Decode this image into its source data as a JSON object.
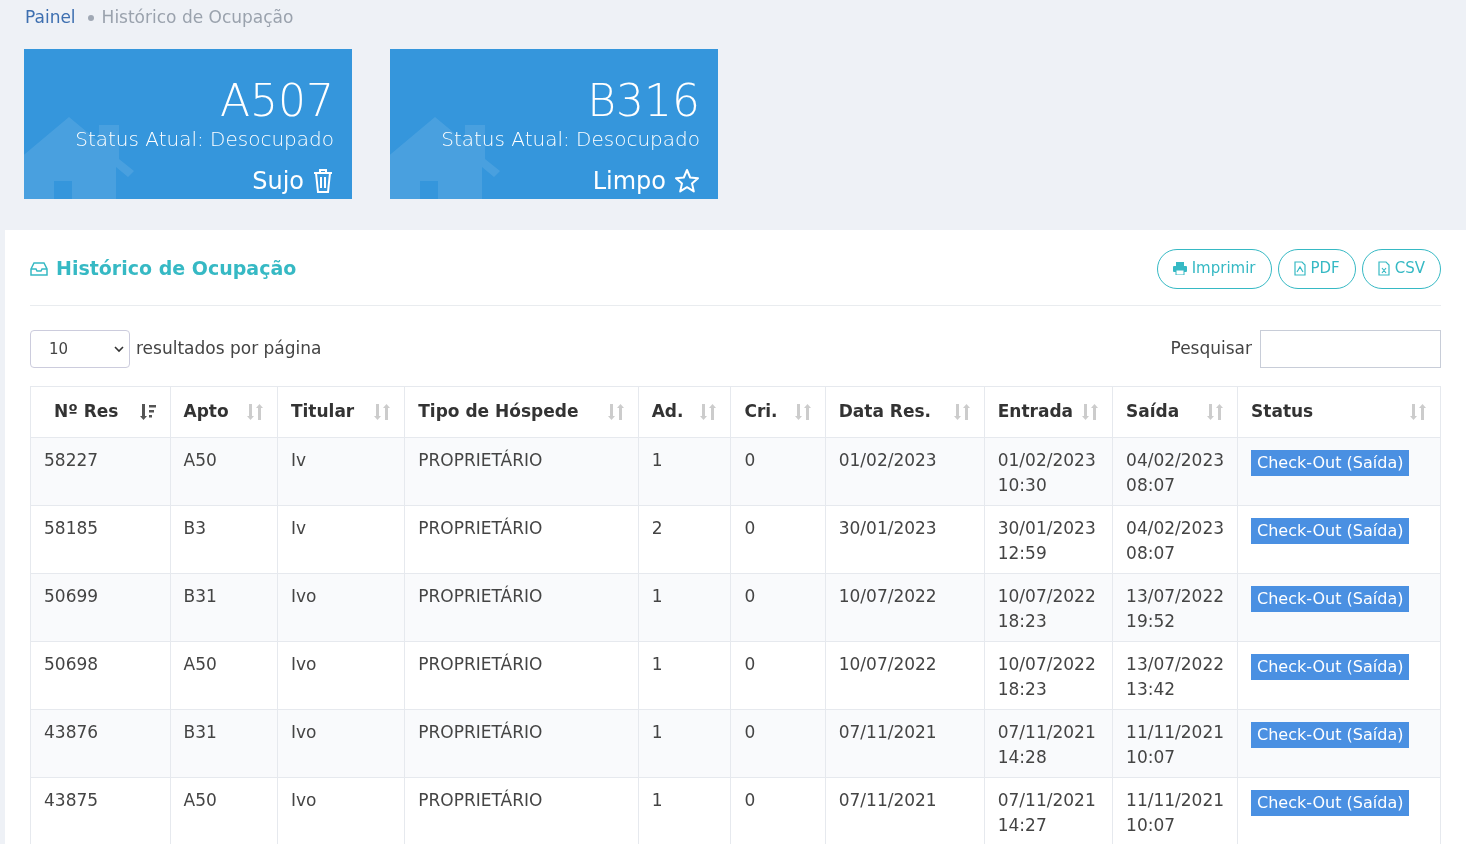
{
  "breadcrumb": [
    {
      "label": "Painel",
      "kind": "link"
    },
    {
      "label": "Histórico de Ocupação",
      "kind": "current"
    }
  ],
  "rooms": [
    {
      "code": "A507",
      "status": "Status Atual: Desocupado",
      "condition": "Sujo",
      "kind": "dirty"
    },
    {
      "code": "B316",
      "status": "Status Atual: Desocupado",
      "condition": "Limpo",
      "kind": "clean"
    }
  ],
  "panel": {
    "title": "Histórico de Ocupação",
    "buttons": [
      {
        "label": "Imprimir",
        "kind": "print"
      },
      {
        "label": "PDF",
        "kind": "pdf"
      },
      {
        "label": "CSV",
        "kind": "csv"
      }
    ]
  },
  "page_size": {
    "value": "10",
    "label": "resultados por página"
  },
  "search": {
    "label": "Pesquisar"
  },
  "table": {
    "columns": [
      {
        "label": "Nº Res",
        "sorted": true
      },
      {
        "label": "Apto",
        "sorted": false
      },
      {
        "label": "Titular",
        "sorted": false
      },
      {
        "label": "Tipo de Hóspede",
        "sorted": false
      },
      {
        "label": "Ad.",
        "sorted": false
      },
      {
        "label": "Cri.",
        "sorted": false
      },
      {
        "label": "Data Res.",
        "sorted": false
      },
      {
        "label": "Entrada",
        "sorted": false
      },
      {
        "label": "Saída",
        "sorted": false
      },
      {
        "label": "Status",
        "sorted": false
      }
    ],
    "rows": [
      {
        "cells": [
          "58227",
          "A50",
          "Iv",
          "PROPRIETÁRIO",
          "1",
          "0",
          "01/02/2023",
          "01/02/2023 10:30",
          "04/02/2023 08:07"
        ],
        "status": "Check-Out (Saída)"
      },
      {
        "cells": [
          "58185",
          "B3",
          "Iv",
          "PROPRIETÁRIO",
          "2",
          "0",
          "30/01/2023",
          "30/01/2023 12:59",
          "04/02/2023 08:07"
        ],
        "status": "Check-Out (Saída)"
      },
      {
        "cells": [
          "50699",
          "B31",
          "Ivo",
          "PROPRIETÁRIO",
          "1",
          "0",
          "10/07/2022",
          "10/07/2022 18:23",
          "13/07/2022 19:52"
        ],
        "status": "Check-Out (Saída)"
      },
      {
        "cells": [
          "50698",
          "A50",
          "Ivo",
          "PROPRIETÁRIO",
          "1",
          "0",
          "10/07/2022",
          "10/07/2022 18:23",
          "13/07/2022 13:42"
        ],
        "status": "Check-Out (Saída)"
      },
      {
        "cells": [
          "43876",
          "B31",
          "Ivo",
          "PROPRIETÁRIO",
          "1",
          "0",
          "07/11/2021",
          "07/11/2021 14:28",
          "11/11/2021 10:07"
        ],
        "status": "Check-Out (Saída)"
      },
      {
        "cells": [
          "43875",
          "A50",
          "Ivo",
          "PROPRIETÁRIO",
          "1",
          "0",
          "07/11/2021",
          "07/11/2021 14:27",
          "11/11/2021 10:07"
        ],
        "status": "Check-Out (Saída)"
      }
    ]
  }
}
